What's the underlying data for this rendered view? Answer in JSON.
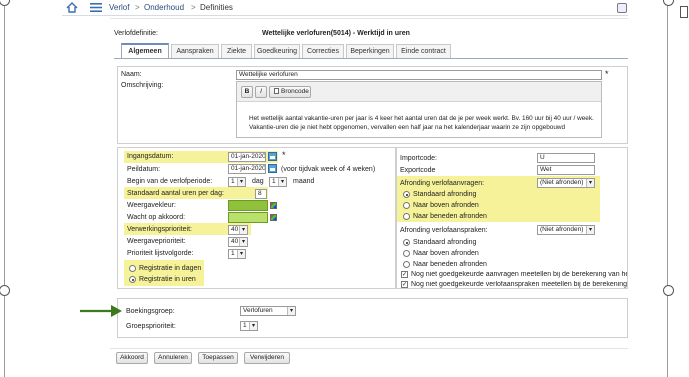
{
  "breadcrumb": {
    "level1": "Verlof",
    "sep1": ">",
    "level2": "Onderhoud",
    "sep2": ">",
    "level3": "Definities"
  },
  "header": {
    "label": "Verlofdefinitie:",
    "title": "Wettelijke verlofuren(5014) - Werktijd in uren"
  },
  "tabs": [
    {
      "label": "Algemeen",
      "active": true
    },
    {
      "label": "Aanspraken"
    },
    {
      "label": "Ziekte"
    },
    {
      "label": "Goedkeuring"
    },
    {
      "label": "Correcties"
    },
    {
      "label": "Beperkingen"
    },
    {
      "label": "Einde contract"
    }
  ],
  "form": {
    "naam_label": "Naam:",
    "naam_value": "Wettelijke verlofuren",
    "required_mark": "*",
    "omschrijving_label": "Omschrijving:",
    "editor": {
      "bold": "B",
      "italic": "I",
      "source": "Broncode"
    },
    "description_line1": "Het wettelijk aantal vakantie-uren per jaar is 4 keer het aantal uren dat de je per week werkt. Bv. 160 uur bij 40 uur / week.",
    "description_line2": "Vakantie-uren die je niet hebt opgenomen, vervallen een half jaar na het kalenderjaar waarin ze zijn opgebouwd"
  },
  "left": {
    "ingangsdatum_label": "Ingangsdatum:",
    "ingangsdatum_value": "01-jan-2020",
    "peildatum_label": "Peildatum:",
    "peildatum_value": "01-jan-2020",
    "peildatum_note": "(voor tijdvak week of 4 weken)",
    "begin_label": "Begin van de verlofperiode:",
    "begin_value": "1",
    "dag_label": "dag",
    "maand_value": "1",
    "maand_label": "maand",
    "standaard_label": "Standaard aantal uren per dag:",
    "standaard_value": "8",
    "weergavekleur_label": "Weergavekleur:",
    "wacht_label": "Wacht op akkoord:",
    "verwerking_label": "Verwerkingsprioriteit:",
    "verwerking_value": "40",
    "weergave_prio_label": "Weergaveprioriteit:",
    "weergave_prio_value": "40",
    "lijst_label": "Prioriteit lijstvolgorde:",
    "lijst_value": "1",
    "reg_dagen": "Registratie in dagen",
    "reg_uren": "Registratie in uren"
  },
  "right": {
    "importcode_label": "Importcode:",
    "importcode_value": "U",
    "exportcode_label": "Exportcode",
    "exportcode_value": "Wet",
    "afronding_aanvr_label": "Afronding verlofaanvragen:",
    "afronding_aanvr_value": "(Niet afronden)",
    "opt_standaard": "Standaard afronding",
    "opt_boven": "Naar boven afronden",
    "opt_beneden": "Naar beneden afronden",
    "afronding_aansp_label": "Afronding verlofaanspraken:",
    "afronding_aansp_value": "(Niet afronden)",
    "opt2_standaard": "Standaard afronding",
    "opt2_boven": "Naar boven afronden",
    "opt2_beneden": "Naar beneden afronden",
    "check1": "Nog niet goedgekeurde aanvragen meetellen bij de berekening van het ve",
    "check2": "Nog niet goedgekeurde verlofaanspraken meetellen bij de berekening van"
  },
  "bottom": {
    "boekingsgroep_label": "Boekingsgroep:",
    "boekingsgroep_value": "Verlofuren",
    "groepsprio_label": "Groepsprioriteit:",
    "groepsprio_value": "1"
  },
  "buttons": {
    "ok": "Akkoord",
    "cancel": "Annuleren",
    "apply": "Toepassen",
    "delete": "Verwijderen"
  },
  "colors": {
    "highlight": "#f6f29a",
    "swatch": "#8fc13b",
    "arrow": "#3d7a1e",
    "tab_accent": "#6d8db8"
  },
  "icons": [
    "home-icon",
    "hamburger-menu-icon",
    "calendar-icon",
    "color-picker-icon",
    "radio-icon",
    "checkbox-icon",
    "green-arrow-icon"
  ]
}
